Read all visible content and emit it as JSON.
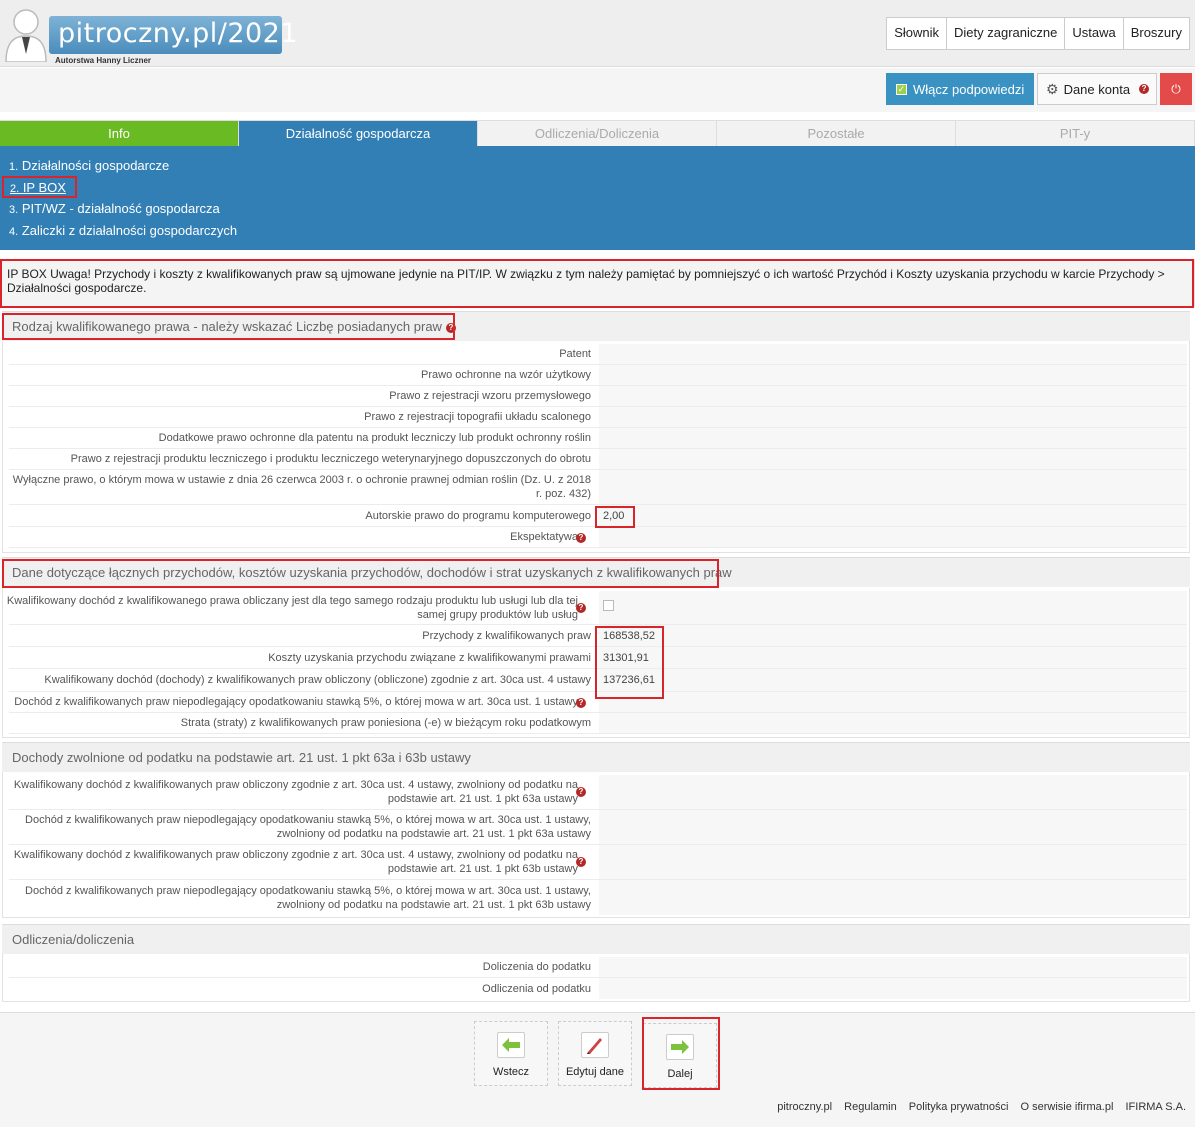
{
  "header": {
    "logo_text": "pitroczny.pl/2021",
    "logo_sub": "Autorstwa Hanny Liczner",
    "nav": [
      "Słownik",
      "Diety zagraniczne",
      "Ustawa",
      "Broszury"
    ],
    "hints_button": "Włącz podpowiedzi",
    "account_button": "Dane konta"
  },
  "tabs": [
    {
      "label": "Info",
      "state": "done"
    },
    {
      "label": "Działalność gospodarcza",
      "state": "active"
    },
    {
      "label": "Odliczenia/Doliczenia",
      "state": "inactive"
    },
    {
      "label": "Pozostałe",
      "state": "inactive"
    },
    {
      "label": "PIT-y",
      "state": "inactive"
    }
  ],
  "submenu": [
    {
      "num": "1.",
      "label": "Działalności gospodarcze"
    },
    {
      "num": "2.",
      "label": "IP BOX"
    },
    {
      "num": "3.",
      "label": "PIT/WZ - działalność gospodarcza"
    },
    {
      "num": "4.",
      "label": "Zaliczki z działalności gospodarczych"
    }
  ],
  "notice": "IP BOX Uwaga! Przychody i koszty z kwalifikowanych praw są ujmowane jedynie na PIT/IP. W związku z tym należy pamiętać by pomniejszyć o ich wartość Przychód i Koszty uzyskania przychodu w karcie Przychody > Działalności gospodarcze.",
  "section1": {
    "title": "Rodzaj kwalifikowanego prawa - należy wskazać Liczbę posiadanych praw",
    "rows": [
      {
        "label": "Patent",
        "value": ""
      },
      {
        "label": "Prawo ochronne na wzór użytkowy",
        "value": ""
      },
      {
        "label": "Prawo z rejestracji wzoru przemysłowego",
        "value": ""
      },
      {
        "label": "Prawo z rejestracji topografii układu scalonego",
        "value": ""
      },
      {
        "label": "Dodatkowe prawo ochronne dla patentu na produkt leczniczy lub produkt ochronny roślin",
        "value": ""
      },
      {
        "label": "Prawo z rejestracji produktu leczniczego i produktu leczniczego weterynaryjnego dopuszczonych do obrotu",
        "value": ""
      },
      {
        "label": "Wyłączne prawo, o którym mowa w ustawie z dnia 26 czerwca 2003 r. o ochronie prawnej odmian roślin (Dz. U. z 2018 r. poz. 432)",
        "value": ""
      },
      {
        "label": "Autorskie prawo do programu komputerowego",
        "value": "2,00"
      },
      {
        "label": "Ekspektatywa",
        "value": ""
      }
    ]
  },
  "section2": {
    "title": "Dane dotyczące łącznych przychodów, kosztów uzyskania przychodów, dochodów i strat uzyskanych z kwalifikowanych praw",
    "rows": [
      {
        "label": "Kwalifikowany dochód z kwalifikowanego prawa obliczany jest dla tego samego rodzaju produktu lub usługi lub dla tej samej grupy produktów lub usług",
        "value": ""
      },
      {
        "label": "Przychody z kwalifikowanych praw",
        "value": "168538,52"
      },
      {
        "label": "Koszty uzyskania przychodu związane z kwalifikowanymi prawami",
        "value": "31301,91"
      },
      {
        "label": "Kwalifikowany dochód (dochody) z kwalifikowanych praw obliczony (obliczone) zgodnie z art. 30ca ust. 4 ustawy",
        "value": "137236,61"
      },
      {
        "label": "Dochód z kwalifikowanych praw niepodlegający opodatkowaniu stawką 5%, o której mowa w art. 30ca ust. 1 ustawy",
        "value": ""
      },
      {
        "label": "Strata (straty) z kwalifikowanych praw poniesiona (-e) w bieżącym roku podatkowym",
        "value": ""
      }
    ]
  },
  "section3": {
    "title": "Dochody zwolnione od podatku na podstawie art. 21 ust. 1 pkt 63a i 63b ustawy",
    "rows": [
      {
        "label": "Kwalifikowany dochód z kwalifikowanych praw obliczony zgodnie z art. 30ca ust. 4 ustawy, zwolniony od podatku na podstawie art. 21 ust. 1 pkt 63a ustawy",
        "value": ""
      },
      {
        "label": "Dochód z kwalifikowanych praw niepodlegający opodatkowaniu stawką 5%, o której mowa w art. 30ca ust. 1 ustawy, zwolniony od podatku na podstawie art. 21 ust. 1 pkt 63a ustawy",
        "value": ""
      },
      {
        "label": "Kwalifikowany dochód z kwalifikowanych praw obliczony zgodnie z art. 30ca ust. 4 ustawy, zwolniony od podatku na podstawie art. 21 ust. 1 pkt 63b ustawy",
        "value": ""
      },
      {
        "label": "Dochód z kwalifikowanych praw niepodlegający opodatkowaniu stawką 5%, o której mowa w art. 30ca ust. 1 ustawy, zwolniony od podatku na podstawie art. 21 ust. 1 pkt 63b ustawy",
        "value": ""
      }
    ]
  },
  "section4": {
    "title": "Odliczenia/doliczenia",
    "rows": [
      {
        "label": "Doliczenia do podatku",
        "value": ""
      },
      {
        "label": "Odliczenia od podatku",
        "value": ""
      }
    ]
  },
  "footer": {
    "back": "Wstecz",
    "edit": "Edytuj dane",
    "next": "Dalej",
    "links": [
      "pitroczny.pl",
      "Regulamin",
      "Polityka prywatności",
      "O serwisie ifirma.pl",
      "IFIRMA S.A."
    ]
  },
  "colors": {
    "blue": "#327fb5",
    "green": "#6aba24",
    "highlight": "#d9242c"
  }
}
